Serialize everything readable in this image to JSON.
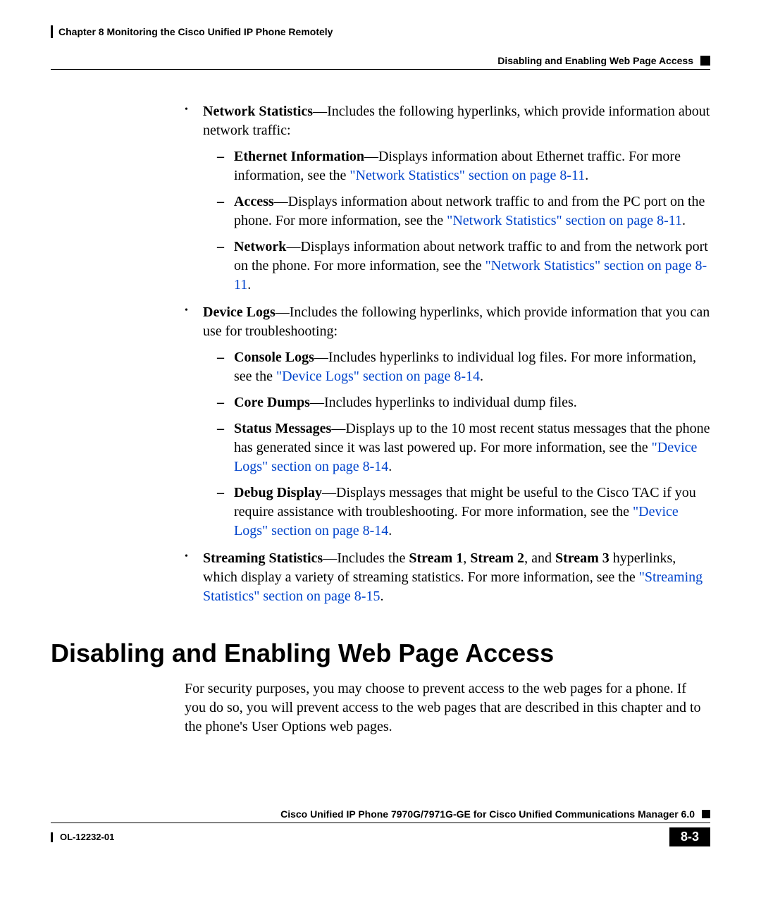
{
  "header": {
    "chapter_label": "Chapter 8      Monitoring the Cisco Unified IP Phone Remotely",
    "section_label": "Disabling and Enabling Web Page Access"
  },
  "bullets": {
    "network_stats": {
      "lead_bold": "Network Statistics",
      "lead_rest": "—Includes the following hyperlinks, which provide information about network traffic:"
    },
    "ethernet": {
      "bold": "Ethernet Information",
      "rest1": "—Displays information about Ethernet traffic. For more information, see the ",
      "link": "\"Network Statistics\" section on page 8-11",
      "rest2": "."
    },
    "access": {
      "bold": "Access",
      "rest1": "—Displays information about network traffic to and from the PC port on the phone. For more information, see the ",
      "link": "\"Network Statistics\" section on page 8-11",
      "rest2": "."
    },
    "network": {
      "bold": "Network",
      "rest1": "—Displays information about network traffic to and from the network port on the phone. For more information, see the ",
      "link": "\"Network Statistics\" section on page 8-11",
      "rest2": "."
    },
    "device_logs": {
      "lead_bold": "Device Logs",
      "lead_rest": "—Includes the following hyperlinks, which provide information that you can use for troubleshooting:"
    },
    "console_logs": {
      "bold": "Console Logs",
      "rest1": "—Includes hyperlinks to individual log files. For more information, see the ",
      "link": "\"Device Logs\" section on page 8-14",
      "rest2": "."
    },
    "core_dumps": {
      "bold": "Core Dumps",
      "rest": "—Includes hyperlinks to individual dump files."
    },
    "status_messages": {
      "bold": "Status Messages",
      "rest1": "—Displays up to the 10 most recent status messages that the phone has generated since it was last powered up. For more information, see the ",
      "link": "\"Device Logs\" section on page 8-14",
      "rest2": "."
    },
    "debug_display": {
      "bold": "Debug Display",
      "rest1": "—Displays messages that might be useful to the Cisco TAC if you require assistance with troubleshooting. For more information, see the ",
      "link": "\"Device Logs\" section on page 8-14",
      "rest2": "."
    },
    "streaming": {
      "bold": "Streaming Statistics",
      "rest1": "—Includes the ",
      "s1": "Stream 1",
      "c1": ", ",
      "s2": "Stream 2",
      "c2": ", and ",
      "s3": "Stream 3",
      "rest2": " hyperlinks, which display a variety of streaming statistics. For more information, see the ",
      "link": "\"Streaming Statistics\" section on page 8-15",
      "rest3": "."
    }
  },
  "heading": "Disabling and Enabling Web Page Access",
  "body_para": "For security purposes, you may choose to prevent access to the web pages for a phone. If you do so, you will prevent access to the web pages that are described in this chapter and to the phone's User Options web pages.",
  "footer": {
    "title": "Cisco Unified IP Phone 7970G/7971G-GE for Cisco Unified Communications Manager 6.0",
    "doc_id": "OL-12232-01",
    "page_number": "8-3"
  }
}
